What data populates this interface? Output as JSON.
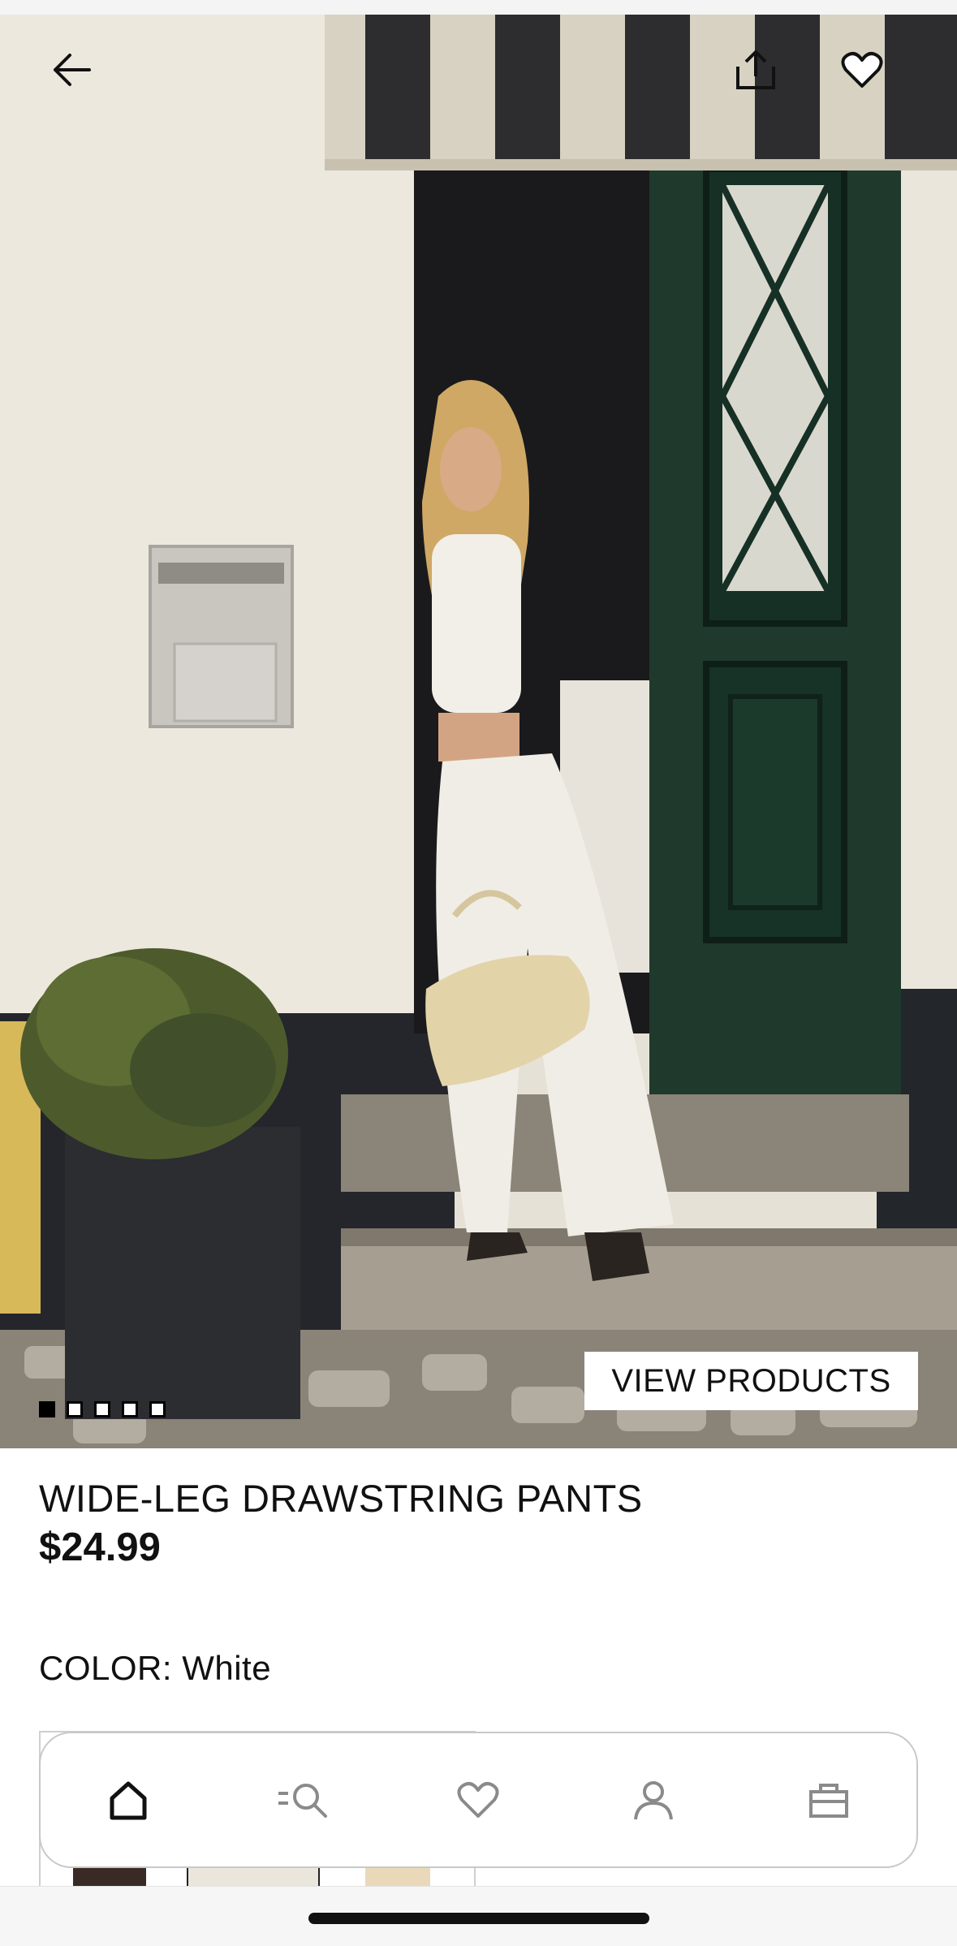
{
  "header": {
    "back_icon": "arrow-left-icon",
    "share_icon": "share-icon",
    "favorite_icon": "heart-icon"
  },
  "gallery": {
    "image_count": 5,
    "active_index": 0,
    "view_products_label": "VIEW PRODUCTS"
  },
  "product": {
    "name": "WIDE-LEG DRAWSTRING PANTS",
    "price": "$24.99",
    "color_label": "COLOR:",
    "color_value": "White"
  },
  "nav": {
    "items": [
      {
        "icon": "home-icon",
        "active": true
      },
      {
        "icon": "search-icon",
        "active": false
      },
      {
        "icon": "heart-icon",
        "active": false
      },
      {
        "icon": "user-icon",
        "active": false
      },
      {
        "icon": "bag-icon",
        "active": false
      }
    ]
  },
  "colors": {
    "text": "#111111",
    "nav_inactive": "#8a8a8a",
    "border": "#c8c8c8"
  }
}
